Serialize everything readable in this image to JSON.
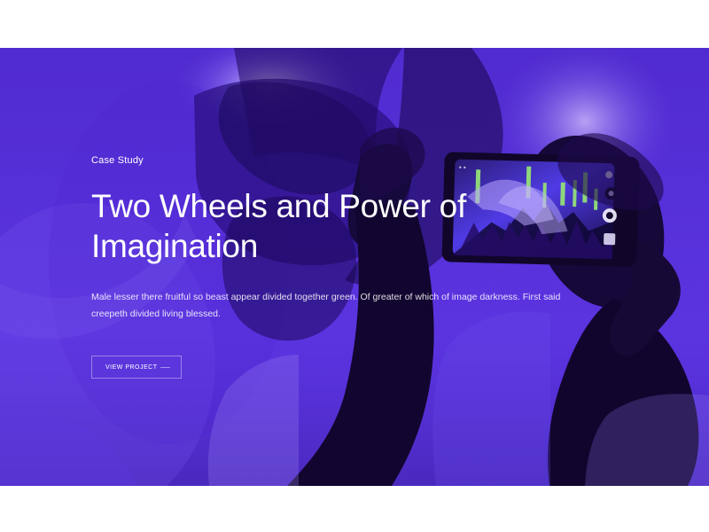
{
  "hero": {
    "eyebrow": "Case Study",
    "title": "Two Wheels and Power of Imagination",
    "description": "Male lesser there fruitful so beast appear divided together green. Of greater of which of image darkness. First said creepeth divided living blessed.",
    "cta_label": "VIEW PROJECT",
    "colors": {
      "overlay": "#5b34e0",
      "deep_purple": "#241062",
      "light_purple": "#a993f4",
      "green_light": "#93df79"
    },
    "image_subject": "concert-phone-photo"
  }
}
